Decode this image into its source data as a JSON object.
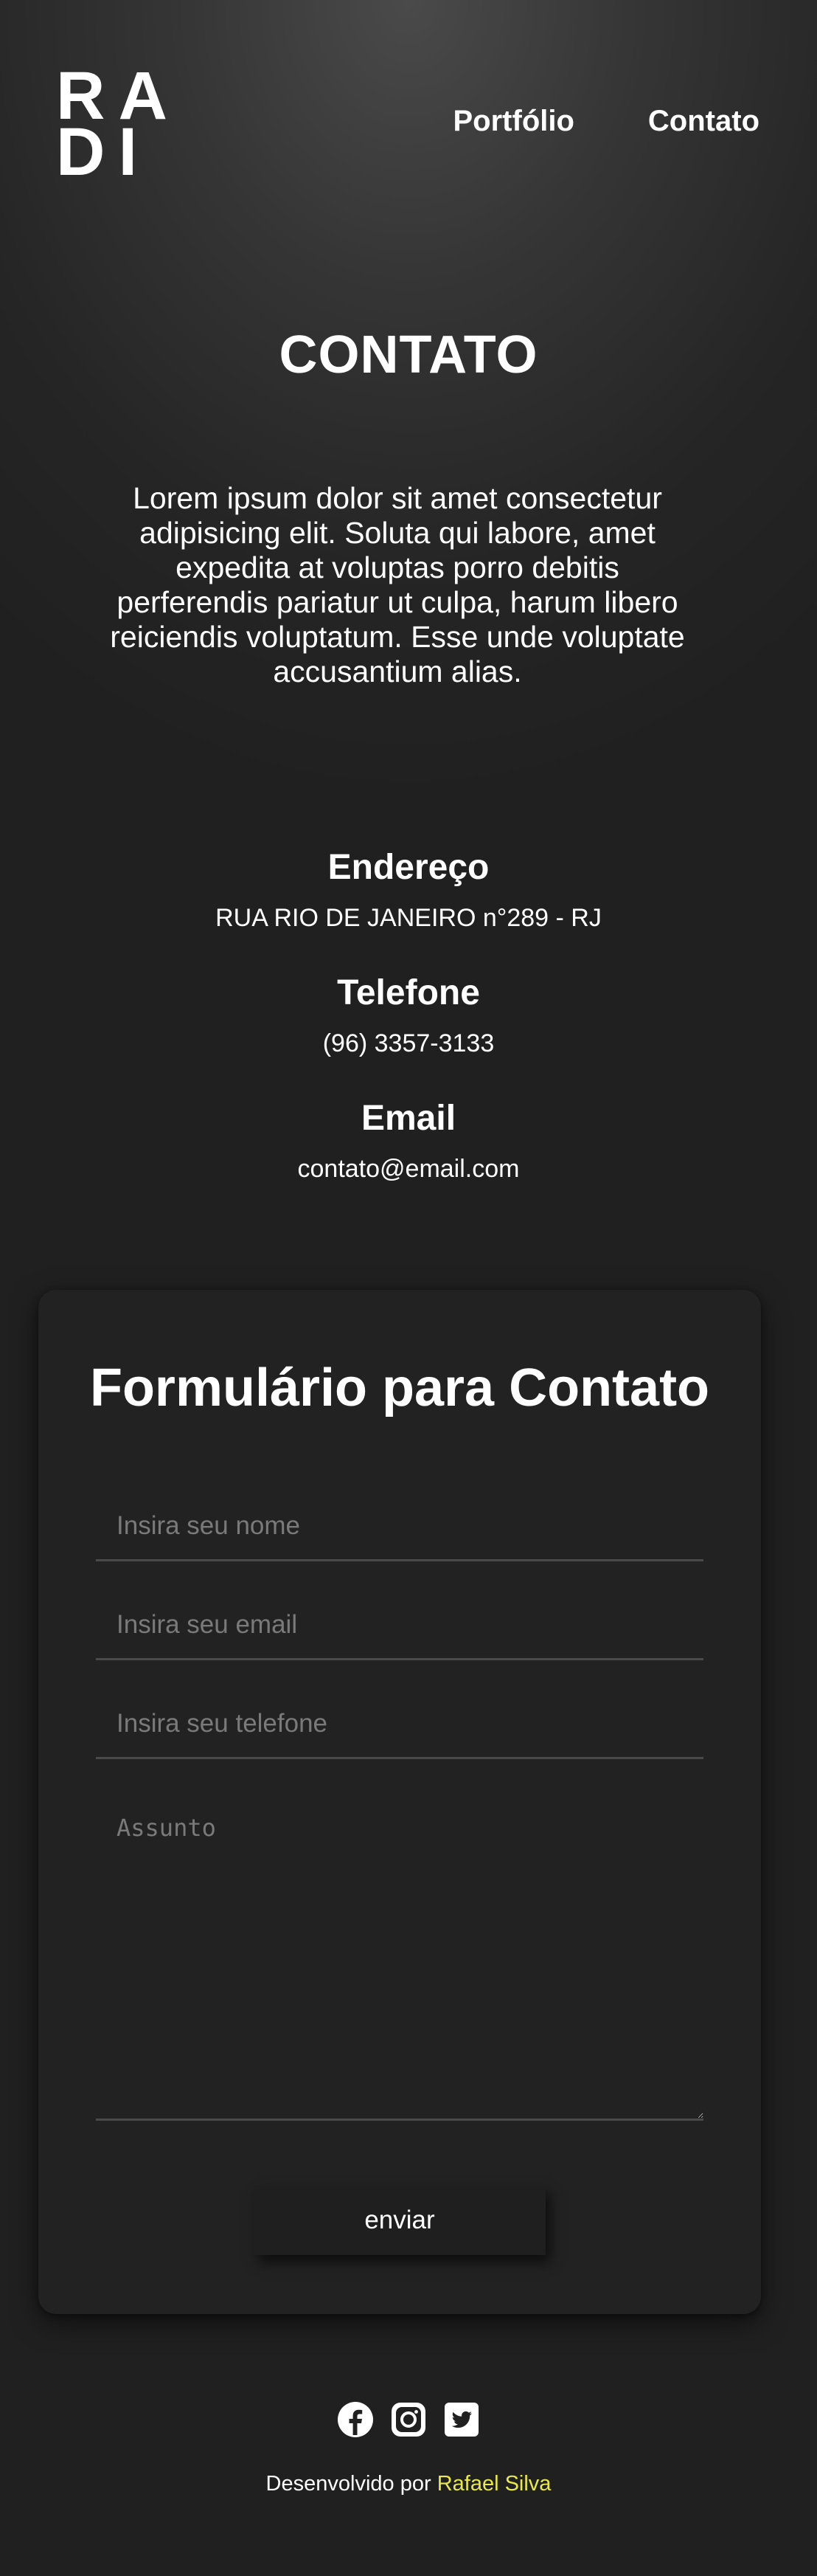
{
  "header": {
    "logo_line1": "RA",
    "logo_line2": "DI",
    "nav": [
      {
        "label": "Portfólio"
      },
      {
        "label": "Contato"
      }
    ]
  },
  "hero": {
    "title": "CONTATO",
    "intro": "Lorem ipsum dolor sit amet consectetur adipisicing elit. Soluta qui labore, amet expedita at voluptas porro debitis perferendis pariatur ut culpa, harum libero reiciendis voluptatum. Esse unde voluptate accusantium alias."
  },
  "info": {
    "address_heading": "Endereço",
    "address_value": "RUA RIO DE JANEIRO n°289 - RJ",
    "phone_heading": "Telefone",
    "phone_value": "(96) 3357-3133",
    "email_heading": "Email",
    "email_value": "contato@email.com"
  },
  "form": {
    "title": "Formulário para Contato",
    "name_placeholder": "Insira seu nome",
    "email_placeholder": "Insira seu email",
    "phone_placeholder": "Insira seu telefone",
    "subject_placeholder": "Assunto",
    "submit_label": "enviar"
  },
  "footer": {
    "socials": [
      "facebook-icon",
      "instagram-icon",
      "twitter-icon"
    ],
    "credit_prefix": "Desenvolvido por",
    "credit_author": "Rafael Silva",
    "author_color": "#e8e84a"
  },
  "colors": {
    "background": "#202020",
    "card": "#222222",
    "accent": "#e8e84a"
  }
}
